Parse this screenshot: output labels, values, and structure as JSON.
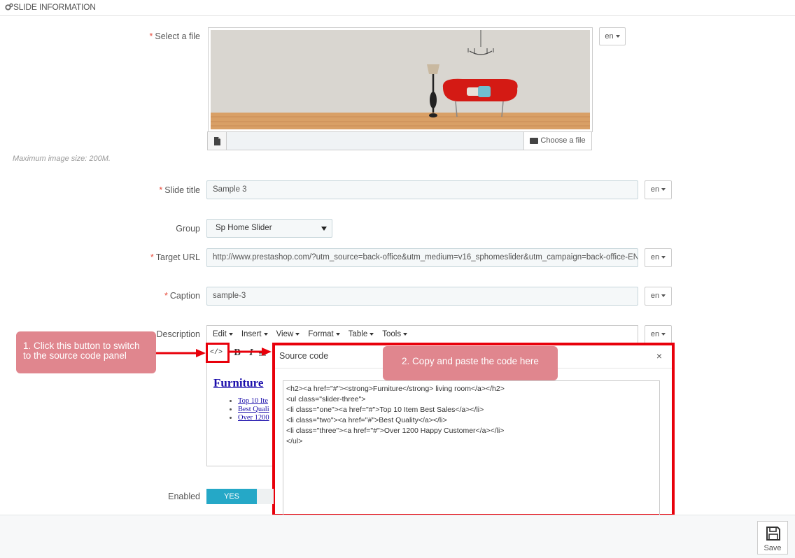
{
  "panel": {
    "title": "SLIDE INFORMATION",
    "icon": "gears-icon"
  },
  "fields": {
    "file": {
      "label": "Select a file",
      "required": "*",
      "lang": "en",
      "choose_label": "Choose a file",
      "hint": "Maximum image size: 200M."
    },
    "title": {
      "label": "Slide title",
      "required": "*",
      "value": "Sample 3",
      "lang": "en"
    },
    "group": {
      "label": "Group",
      "value": "Sp Home Slider"
    },
    "url": {
      "label": "Target URL",
      "required": "*",
      "value": "http://www.prestashop.com/?utm_source=back-office&utm_medium=v16_sphomeslider&utm_campaign=back-office-EN",
      "lang": "en"
    },
    "caption": {
      "label": "Caption",
      "required": "*",
      "value": "sample-3",
      "lang": "en"
    },
    "description": {
      "label": "Description",
      "lang": "en"
    },
    "enabled": {
      "label": "Enabled",
      "yes": "YES"
    }
  },
  "editor": {
    "menu": [
      "Edit",
      "Insert",
      "View",
      "Format",
      "Table",
      "Tools"
    ],
    "toolbar": {
      "bold": "B",
      "italic": "I"
    },
    "preview": {
      "heading": "Furniture",
      "items": [
        "Top 10 Ite",
        "Best Quali",
        "Over 1200"
      ]
    }
  },
  "modal": {
    "title": "Source code",
    "close": "×",
    "code": [
      "<h2><a href=\"#\"><strong>Furniture</strong> living room</a></h2>",
      "<ul class=\"slider-three\">",
      "<li class=\"one\"><a href=\"#\">Top 10 Item Best Sales</a></li>",
      "<li class=\"two\"><a href=\"#\">Best Quality</a></li>",
      "<li class=\"three\"><a href=\"#\">Over 1200 Happy Customer</a></li>",
      "</ul>"
    ]
  },
  "callouts": {
    "one": "1. Click this button to switch to the source code panel",
    "two": "2. Copy and paste the code here"
  },
  "footer": {
    "save": "Save"
  },
  "colors": {
    "accent": "#25a8c7",
    "highlight": "#e8000b",
    "callout": "#e0868e",
    "required": "#e74c3c"
  }
}
